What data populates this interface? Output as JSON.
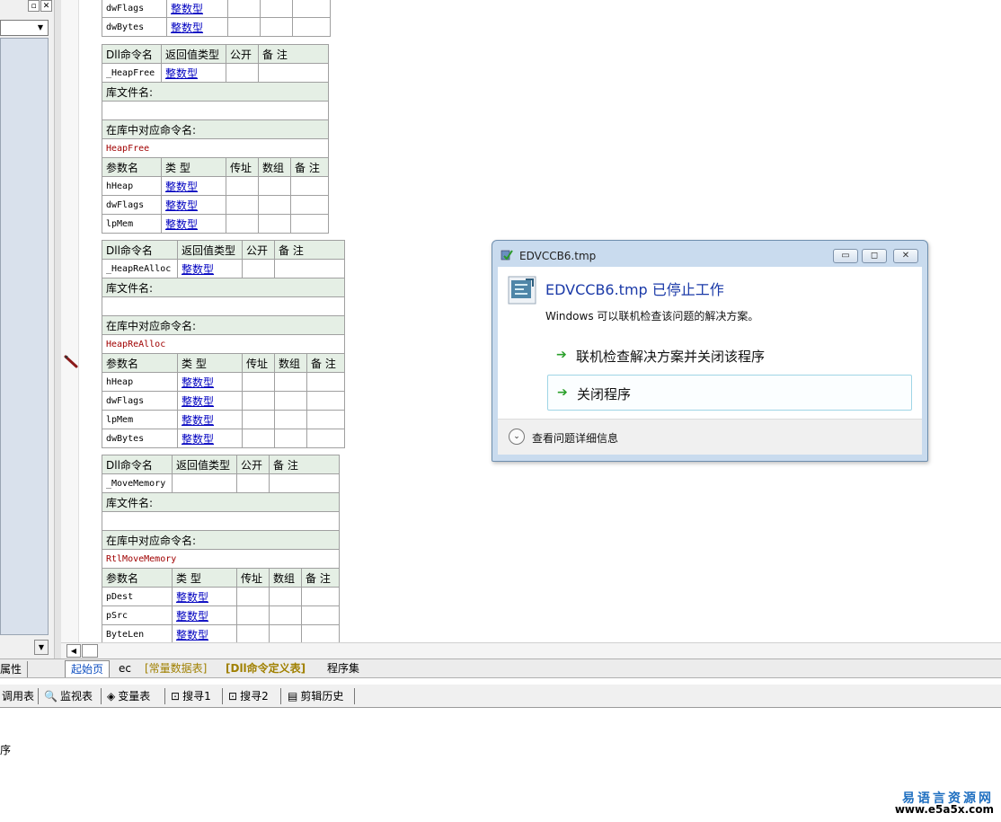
{
  "left_panel": {
    "restore_glyph": "▫",
    "close_glyph": "✕",
    "combo_arrow": "▼",
    "scroll_down_glyph": "▼"
  },
  "tables": {
    "t1": {
      "rows": [
        {
          "name": "dwFlags",
          "type": "整数型"
        },
        {
          "name": "dwBytes",
          "type": "整数型"
        }
      ]
    },
    "t2": {
      "cmd_header": [
        "Dll命令名",
        "返回值类型",
        "公开",
        "备 注"
      ],
      "cmd_name": "_HeapFree",
      "cmd_return": "整数型",
      "lib_header": "库文件名:",
      "lib_value": "",
      "entry_header": "在库中对应命令名:",
      "entry_value": "HeapFree",
      "param_header": [
        "参数名",
        "类 型",
        "传址",
        "数组",
        "备 注"
      ],
      "params": [
        {
          "name": "hHeap",
          "type": "整数型"
        },
        {
          "name": "dwFlags",
          "type": "整数型"
        },
        {
          "name": "lpMem",
          "type": "整数型"
        }
      ]
    },
    "t3": {
      "cmd_header": [
        "Dll命令名",
        "返回值类型",
        "公开",
        "备 注"
      ],
      "cmd_name": "_HeapReAlloc",
      "cmd_return": "整数型",
      "lib_header": "库文件名:",
      "lib_value": "",
      "entry_header": "在库中对应命令名:",
      "entry_value": "HeapReAlloc",
      "param_header": [
        "参数名",
        "类 型",
        "传址",
        "数组",
        "备 注"
      ],
      "params": [
        {
          "name": "hHeap",
          "type": "整数型"
        },
        {
          "name": "dwFlags",
          "type": "整数型"
        },
        {
          "name": "lpMem",
          "type": "整数型"
        },
        {
          "name": "dwBytes",
          "type": "整数型"
        }
      ]
    },
    "t4": {
      "cmd_header": [
        "Dll命令名",
        "返回值类型",
        "公开",
        "备 注"
      ],
      "cmd_name": "_MoveMemory",
      "cmd_return": "",
      "lib_header": "库文件名:",
      "lib_value": "",
      "entry_header": "在库中对应命令名:",
      "entry_value": "RtlMoveMemory",
      "param_header": [
        "参数名",
        "类 型",
        "传址",
        "数组",
        "备 注"
      ],
      "params": [
        {
          "name": "pDest",
          "type": "整数型"
        },
        {
          "name": "pSrc",
          "type": "整数型"
        },
        {
          "name": "ByteLen",
          "type": "整数型"
        }
      ]
    }
  },
  "scrollbar": {
    "left_glyph": "◀"
  },
  "tabbar": {
    "property_tab": "属性",
    "tabs": [
      "起始页",
      "ec",
      "[常量数据表]",
      "[Dll命令定义表]",
      "程序集"
    ]
  },
  "toolbar": {
    "items": [
      "调用表",
      "监视表",
      "变量表",
      "搜寻1",
      "搜寻2",
      "剪辑历史"
    ],
    "icons": {
      "search": "🔍",
      "variable": "◈",
      "find1": "⊡",
      "find2": "⊡",
      "clip": "▤"
    }
  },
  "output": {
    "text": "序"
  },
  "watermark": {
    "title": "易语言资源网",
    "url": "www.e5a5x.com"
  },
  "dialog": {
    "title": "EDVCCB6.tmp",
    "heading": "EDVCCB6.tmp 已停止工作",
    "description": "Windows 可以联机检查该问题的解决方案。",
    "option_check_online": "联机检查解决方案并关闭该程序",
    "option_close": "关闭程序",
    "footer_label": "查看问题详细信息",
    "min_glyph": "▭",
    "max_glyph": "◻",
    "close_glyph": "✕",
    "arrow_glyph": "➔",
    "expand_glyph": "⌄"
  }
}
